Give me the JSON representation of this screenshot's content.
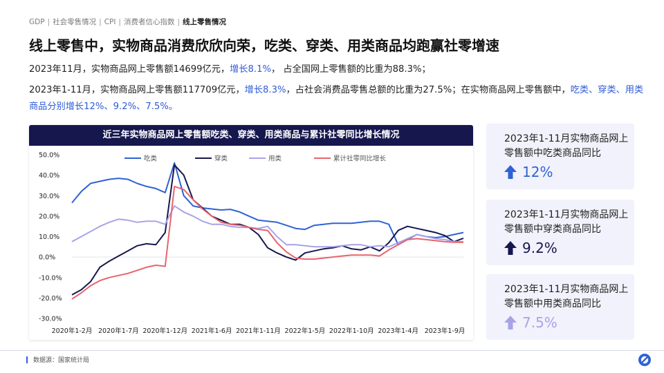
{
  "breadcrumb": {
    "items": [
      "GDP",
      "社会零售情况",
      "CPI",
      "消费者信心指数"
    ],
    "active": "线上零售情况",
    "separator": "|"
  },
  "headline": "线上零售中，实物商品消费欣欣向荣，吃类、穿类、用类商品均跑赢社零增速",
  "para1": {
    "part1": "2023年11月，实物商品网上零售额14699亿元，",
    "highlight1": "增长8.1%",
    "part2": "， 占全国网上零售额的比重为88.3%；"
  },
  "para2": {
    "part1": "2023年1-11月，实物商品网上零售额117709亿元，",
    "highlight1": "增长8.3%",
    "part2": "，占社会消费品零售总额的比重为27.5%；在实物商品网上零售额中，",
    "highlight2": "吃类、穿类、用类商品分别增长12%、9.2%、7.5%。"
  },
  "chart_title": "近三年实物商品网上零售额吃类、穿类、用类商品与累计社零同比增长情况",
  "chart_data": {
    "type": "line",
    "title": "近三年实物商品网上零售额吃类、穿类、用类商品与累计社零同比增长情况",
    "xlabel": "",
    "ylabel": "",
    "ylim": [
      -30,
      50
    ],
    "y_ticks": [
      "50.0%",
      "40.0%",
      "30.0%",
      "20.0%",
      "10.0%",
      "0.0%",
      "-10.0%",
      "-20.0%",
      "-30.0%"
    ],
    "x_tick_labels": [
      "2020年1-2月",
      "2020年1-7月",
      "2020年1-12月",
      "2021年1-6月",
      "2021年1-11月",
      "2022年1-5月",
      "2022年1-10月",
      "2023年1-4月",
      "2023年1-9月"
    ],
    "x_tick_index": [
      0,
      5,
      10,
      15,
      20,
      25,
      30,
      35,
      40
    ],
    "x_count": 43,
    "legend_position": "top",
    "grid": false,
    "series": [
      {
        "name": "吃类",
        "color": "#2f62d4",
        "values": [
          26.5,
          32,
          36,
          37,
          38,
          38.5,
          38,
          36,
          34.5,
          33.5,
          31.5,
          46,
          30,
          25,
          24,
          23.5,
          23,
          23.3,
          22,
          20,
          18,
          17.5,
          17,
          15.5,
          14,
          13.5,
          15.5,
          16,
          16.5,
          16.5,
          16.5,
          17,
          17.5,
          17.5,
          16,
          6,
          8.5,
          11,
          10,
          9.5,
          10,
          11,
          12
        ]
      },
      {
        "name": "穿类",
        "color": "#16174d",
        "values": [
          -18.5,
          -16,
          -12,
          -5,
          -2,
          0.5,
          3,
          5.5,
          6.5,
          6,
          12,
          45,
          40,
          28,
          24,
          20,
          18,
          16,
          16,
          14.5,
          11,
          4.5,
          2,
          0,
          -1.5,
          2,
          3,
          4,
          4.5,
          5.5,
          4,
          3.5,
          5,
          3,
          7,
          13,
          15,
          14,
          13,
          12,
          10.5,
          7.5,
          9.2
        ]
      },
      {
        "name": "用类",
        "color": "#a7a3e9",
        "values": [
          7.5,
          10,
          12.5,
          15,
          17,
          18.5,
          18,
          17,
          17.5,
          17.5,
          16,
          25,
          22,
          20,
          17.5,
          16,
          16,
          15,
          14.5,
          14.5,
          14,
          15,
          10,
          6,
          6,
          5.5,
          5,
          5,
          5,
          5.5,
          6,
          6,
          5,
          5.5,
          5,
          7,
          9,
          11,
          10,
          9,
          8.5,
          7.5,
          7.5
        ]
      },
      {
        "name": "累计社零同比增长",
        "color": "#e8636c",
        "values": [
          -20.5,
          -17.5,
          -14,
          -11.5,
          -10,
          -9,
          -8,
          -6.5,
          -5,
          -4,
          -4.5,
          34.5,
          33,
          28,
          23.5,
          20,
          17,
          16,
          15.5,
          14.5,
          13.5,
          13,
          7,
          2.5,
          -0.5,
          -1,
          -1,
          -0.5,
          0,
          0.5,
          1,
          1,
          1,
          0.5,
          3.5,
          6,
          8.5,
          9,
          8.5,
          8,
          7.5,
          7.2,
          7.2
        ]
      }
    ]
  },
  "cards": [
    {
      "text": "2023年1-11月实物商品网上零售额中吃类商品同比",
      "value": "12%",
      "color": "#2f62d4",
      "icon": "arrow-up-icon"
    },
    {
      "text": "2023年1-11月实物商品网上零售额中穿类商品同比",
      "value": "9.2%",
      "color": "#16174d",
      "icon": "arrow-up-icon"
    },
    {
      "text": "2023年1-11月实物商品网上零售额中用类商品同比",
      "value": "7.5%",
      "color": "#a7a3e9",
      "icon": "arrow-up-icon"
    }
  ],
  "source": "数据源：国家统计局",
  "logo_icon": "ring-logo-icon"
}
